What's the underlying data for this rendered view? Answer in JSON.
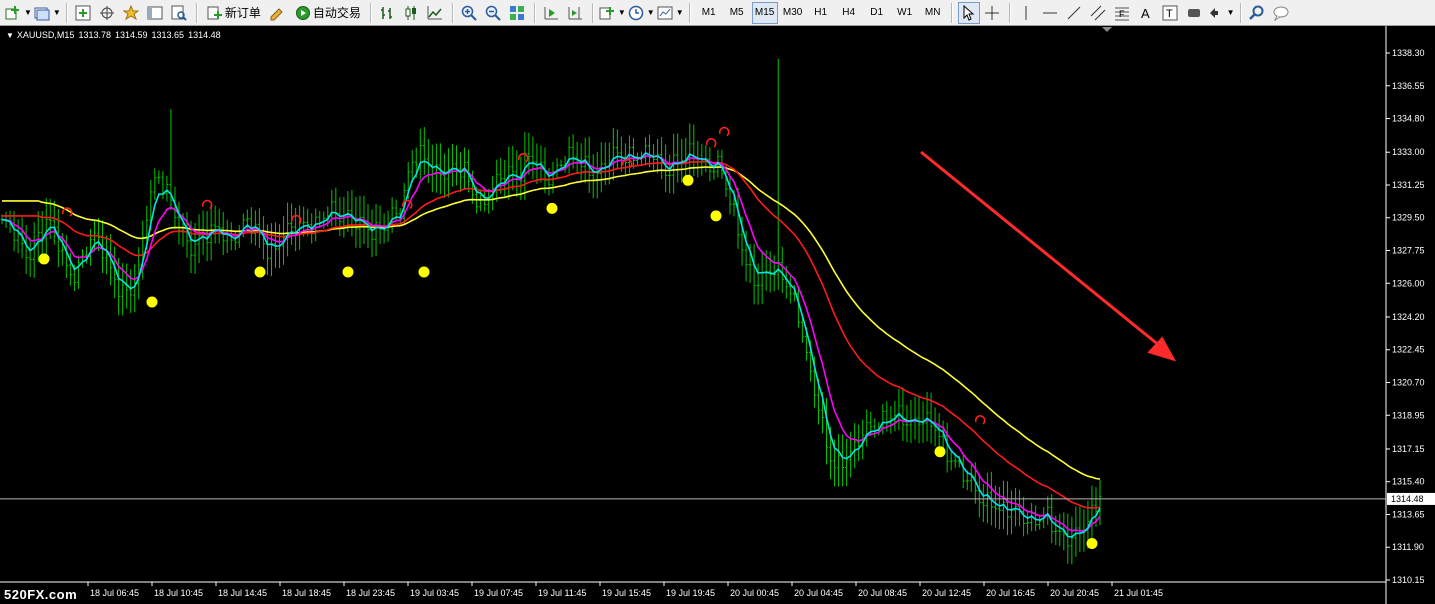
{
  "toolbar": {
    "new_order_label": "新订单",
    "auto_trade_label": "自动交易",
    "timeframes": [
      "M1",
      "M5",
      "M15",
      "M30",
      "H1",
      "H4",
      "D1",
      "W1",
      "MN"
    ],
    "active_timeframe": "M15"
  },
  "chart_header": {
    "symbol": "XAUUSD,M15",
    "open": "1313.78",
    "high": "1314.59",
    "low": "1313.65",
    "close": "1314.48"
  },
  "watermark": "520FX.com",
  "colors": {
    "background": "#000000",
    "candles": "#00c800",
    "ma_fast": "#00e5e5",
    "ma_mid": "#ff00ff",
    "ma_slow": "#ff1a1a",
    "ma_long": "#ffff33",
    "signal_dot": "#ffff00",
    "signal_ring": "#ff2020",
    "arrow": "#ff2a2a"
  },
  "chart_data": {
    "type": "line",
    "title": "XAUUSD,M15",
    "ylim": [
      1310.15,
      1339.5
    ],
    "y_ticks": [
      "1338.30",
      "1336.55",
      "1334.80",
      "1333.00",
      "1331.25",
      "1329.50",
      "1327.75",
      "1326.00",
      "1324.20",
      "1322.45",
      "1320.70",
      "1318.95",
      "1317.15",
      "1315.40",
      "1313.65",
      "1311.90",
      "1310.15"
    ],
    "current_price": "1314.48",
    "x_ticks": [
      "18 Jul 06:45",
      "18 Jul 10:45",
      "18 Jul 14:45",
      "18 Jul 18:45",
      "18 Jul 23:45",
      "19 Jul 03:45",
      "19 Jul 07:45",
      "19 Jul 11:45",
      "19 Jul 15:45",
      "19 Jul 19:45",
      "20 Jul 00:45",
      "20 Jul 04:45",
      "20 Jul 08:45",
      "20 Jul 12:45",
      "20 Jul 16:45",
      "20 Jul 20:45",
      "21 Jul 01:45"
    ],
    "bars": 274,
    "series": [
      {
        "key": "price",
        "values": [
          1329.2,
          1328.8,
          1328.0,
          1327.6,
          1328.6,
          1329.2,
          1328.4,
          1327.0,
          1326.6,
          1327.4,
          1328.3,
          1328.0,
          1326.9,
          1325.7,
          1325.2,
          1326.3,
          1330.2,
          1332.0,
          1331.0,
          1329.5,
          1328.4,
          1328.1,
          1328.6,
          1328.5,
          1328.9,
          1328.3,
          1328.9,
          1329.2,
          1328.6,
          1328.0,
          1327.9,
          1328.6,
          1328.7,
          1329.0,
          1329.4,
          1329.3,
          1329.8,
          1329.4,
          1329.8,
          1329.6,
          1328.9,
          1328.4,
          1329.0,
          1329.9,
          1330.0,
          1332.1,
          1332.8,
          1332.6,
          1332.0,
          1331.8,
          1331.9,
          1332.1,
          1330.9,
          1330.1,
          1330.8,
          1331.6,
          1332.2,
          1331.8,
          1332.7,
          1332.1,
          1331.6,
          1332.2,
          1332.7,
          1332.5,
          1332.4,
          1332.0,
          1332.1,
          1332.6,
          1332.7,
          1332.9,
          1333.0,
          1332.8,
          1332.6,
          1331.9,
          1332.6,
          1332.8,
          1332.7,
          1332.4,
          1332.4,
          1332.6,
          1330.7,
          1328.8,
          1327.1,
          1326.3,
          1326.4,
          1326.5,
          1326.3,
          1325.7,
          1324.0,
          1321.0,
          1319.2,
          1317.1,
          1316.4,
          1316.6,
          1316.9,
          1318.2,
          1318.6,
          1318.7,
          1318.7,
          1318.8,
          1318.6,
          1319.0,
          1318.5,
          1318.0,
          1317.0,
          1316.7,
          1315.8,
          1314.9,
          1314.1,
          1314.6,
          1314.0,
          1313.8,
          1313.5,
          1313.4,
          1313.6,
          1313.7,
          1312.6,
          1312.3,
          1312.7,
          1313.0,
          1313.3,
          1314.5
        ],
        "color_key": "ma_fast"
      }
    ],
    "signal_dots_y": [
      1327.3,
      1325.0,
      1326.6,
      1326.6,
      1326.6,
      1330.0,
      1331.5,
      1329.6,
      1317.0,
      1312.1
    ],
    "signal_rings_y": [
      1329.8,
      1330.2,
      1329.4,
      1330.2,
      1332.7,
      1332.4,
      1333.5,
      1334.1,
      1318.7
    ],
    "annotation": "down-arrow"
  }
}
